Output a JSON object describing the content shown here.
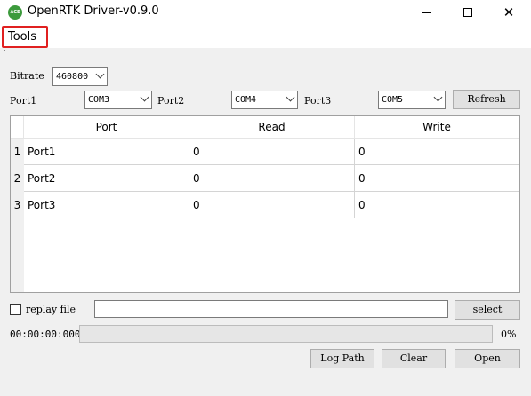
{
  "window": {
    "title": "OpenRTK Driver-v0.9.0",
    "icon_text": "ACE",
    "controls": {
      "close_glyph": "✕"
    }
  },
  "menu": {
    "tools": "Tools"
  },
  "settings": {
    "bitrate_label": "Bitrate",
    "bitrate_value": "460800",
    "port1_label": "Port1",
    "port1_value": "COM3",
    "port2_label": "Port2",
    "port2_value": "COM4",
    "port3_label": "Port3",
    "port3_value": "COM5",
    "refresh_label": "Refresh"
  },
  "table": {
    "columns": [
      "Port",
      "Read",
      "Write"
    ],
    "rows": [
      {
        "num": "1",
        "port": "Port1",
        "read": "0",
        "write": "0"
      },
      {
        "num": "2",
        "port": "Port2",
        "read": "0",
        "write": "0"
      },
      {
        "num": "3",
        "port": "Port3",
        "read": "0",
        "write": "0"
      }
    ]
  },
  "replay": {
    "checkbox_label": "replay file",
    "file_value": "",
    "select_label": "select"
  },
  "status": {
    "elapsed": "00:00:00:000",
    "progress": 0,
    "progress_text": "0%"
  },
  "actions": {
    "log_path_label": "Log Path",
    "clear_label": "Clear",
    "open_label": "Open"
  }
}
